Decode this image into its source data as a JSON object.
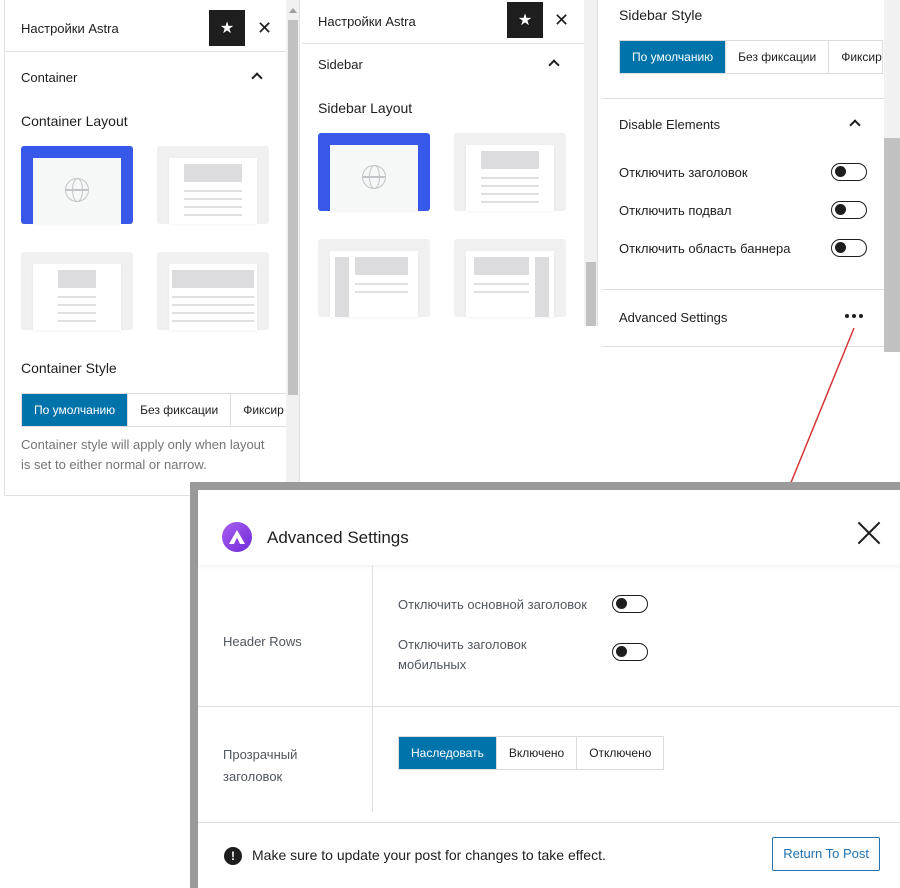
{
  "panel1": {
    "title": "Настройки Astra",
    "close": "✕",
    "section": "Container",
    "layout_label": "Container Layout",
    "style_label": "Container Style",
    "style_options": [
      "По умолчанию",
      "Без фиксации",
      "Фиксир"
    ],
    "help_text_1": "Container style will apply only when layout",
    "help_text_2": "is set to either normal or narrow."
  },
  "panel2": {
    "title": "Настройки Astra",
    "close": "✕",
    "section": "Sidebar",
    "layout_label": "Sidebar Layout"
  },
  "panel3": {
    "style_label": "Sidebar Style",
    "style_options": [
      "По умолчанию",
      "Без фиксации",
      "Фиксир"
    ],
    "section": "Disable Elements",
    "toggles": [
      {
        "label": "Отключить заголовок"
      },
      {
        "label": "Отключить подвал"
      },
      {
        "label": "Отключить область баннера"
      }
    ],
    "advanced_label": "Advanced Settings"
  },
  "modal": {
    "title": "Advanced Settings",
    "header_rows_label": "Header Rows",
    "option_1": "Отключить основной заголовок",
    "option_2_line1": "Отключить заголовок",
    "option_2_line2": "мобильных",
    "transparent_line1": "Прозрачный",
    "transparent_line2": "заголовок",
    "transparent_options": [
      "Наследовать",
      "Включено",
      "Отключено"
    ],
    "footer_text": "Make sure to update your post for changes to take effect.",
    "return_button": "Return To Post"
  },
  "colors": {
    "accent": "#0073aa",
    "selected_layout": "#3858e9",
    "arrow": "#d63638",
    "brand_logo": "#8a3ff0"
  },
  "icons": [
    "star-icon",
    "close-icon",
    "chevron-up-icon",
    "globe-icon",
    "more-dots-icon",
    "astra-logo",
    "warning-icon"
  ]
}
